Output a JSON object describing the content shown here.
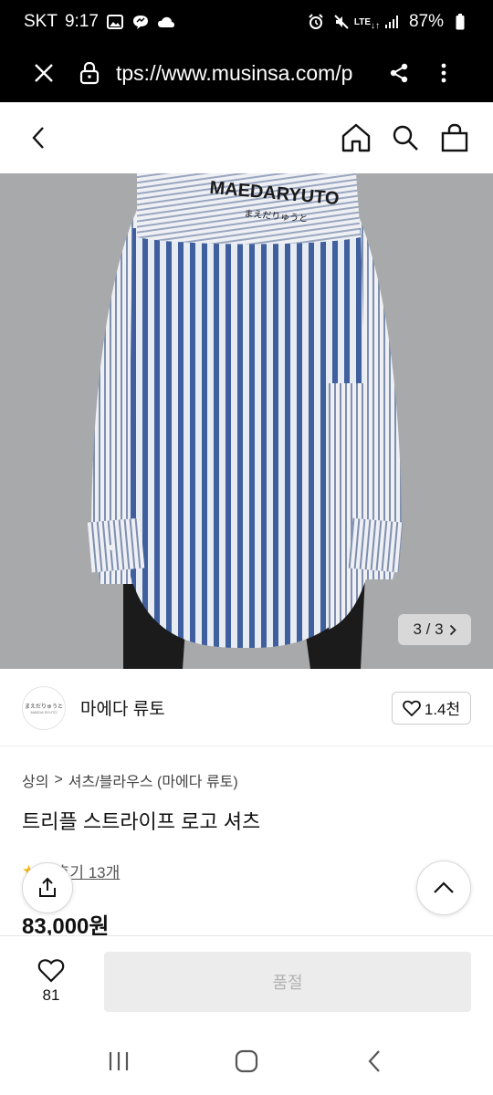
{
  "status": {
    "carrier": "SKT",
    "time": "9:17",
    "network": "LTE",
    "battery": "87%"
  },
  "browser": {
    "url": "tps://www.musinsa.com/p"
  },
  "product": {
    "image_counter": "3 / 3",
    "shirt_print": "MAEDARYUTO",
    "shirt_print_sub": "まえだりゅうと",
    "brand_logo_text": "まえだりゅうと",
    "brand_logo_sub": "MAEDA RYUTO",
    "brand_name": "마에다 류토",
    "brand_likes": "1.4천",
    "breadcrumb": {
      "level1": "상의",
      "separator": ">",
      "level2": "셔츠/블라우스 (마에다 류토)"
    },
    "title": "트리플 스트라이프 로고 셔츠",
    "rating_partial": "1",
    "review_label": "후기 13개",
    "price": "83,000원"
  },
  "bottom": {
    "wish_count": "81",
    "soldout_label": "품절"
  },
  "colors": {
    "accent_star": "#f5b400",
    "stripe_blue": "#3f5f9e",
    "soldout_bg": "#ececec"
  }
}
